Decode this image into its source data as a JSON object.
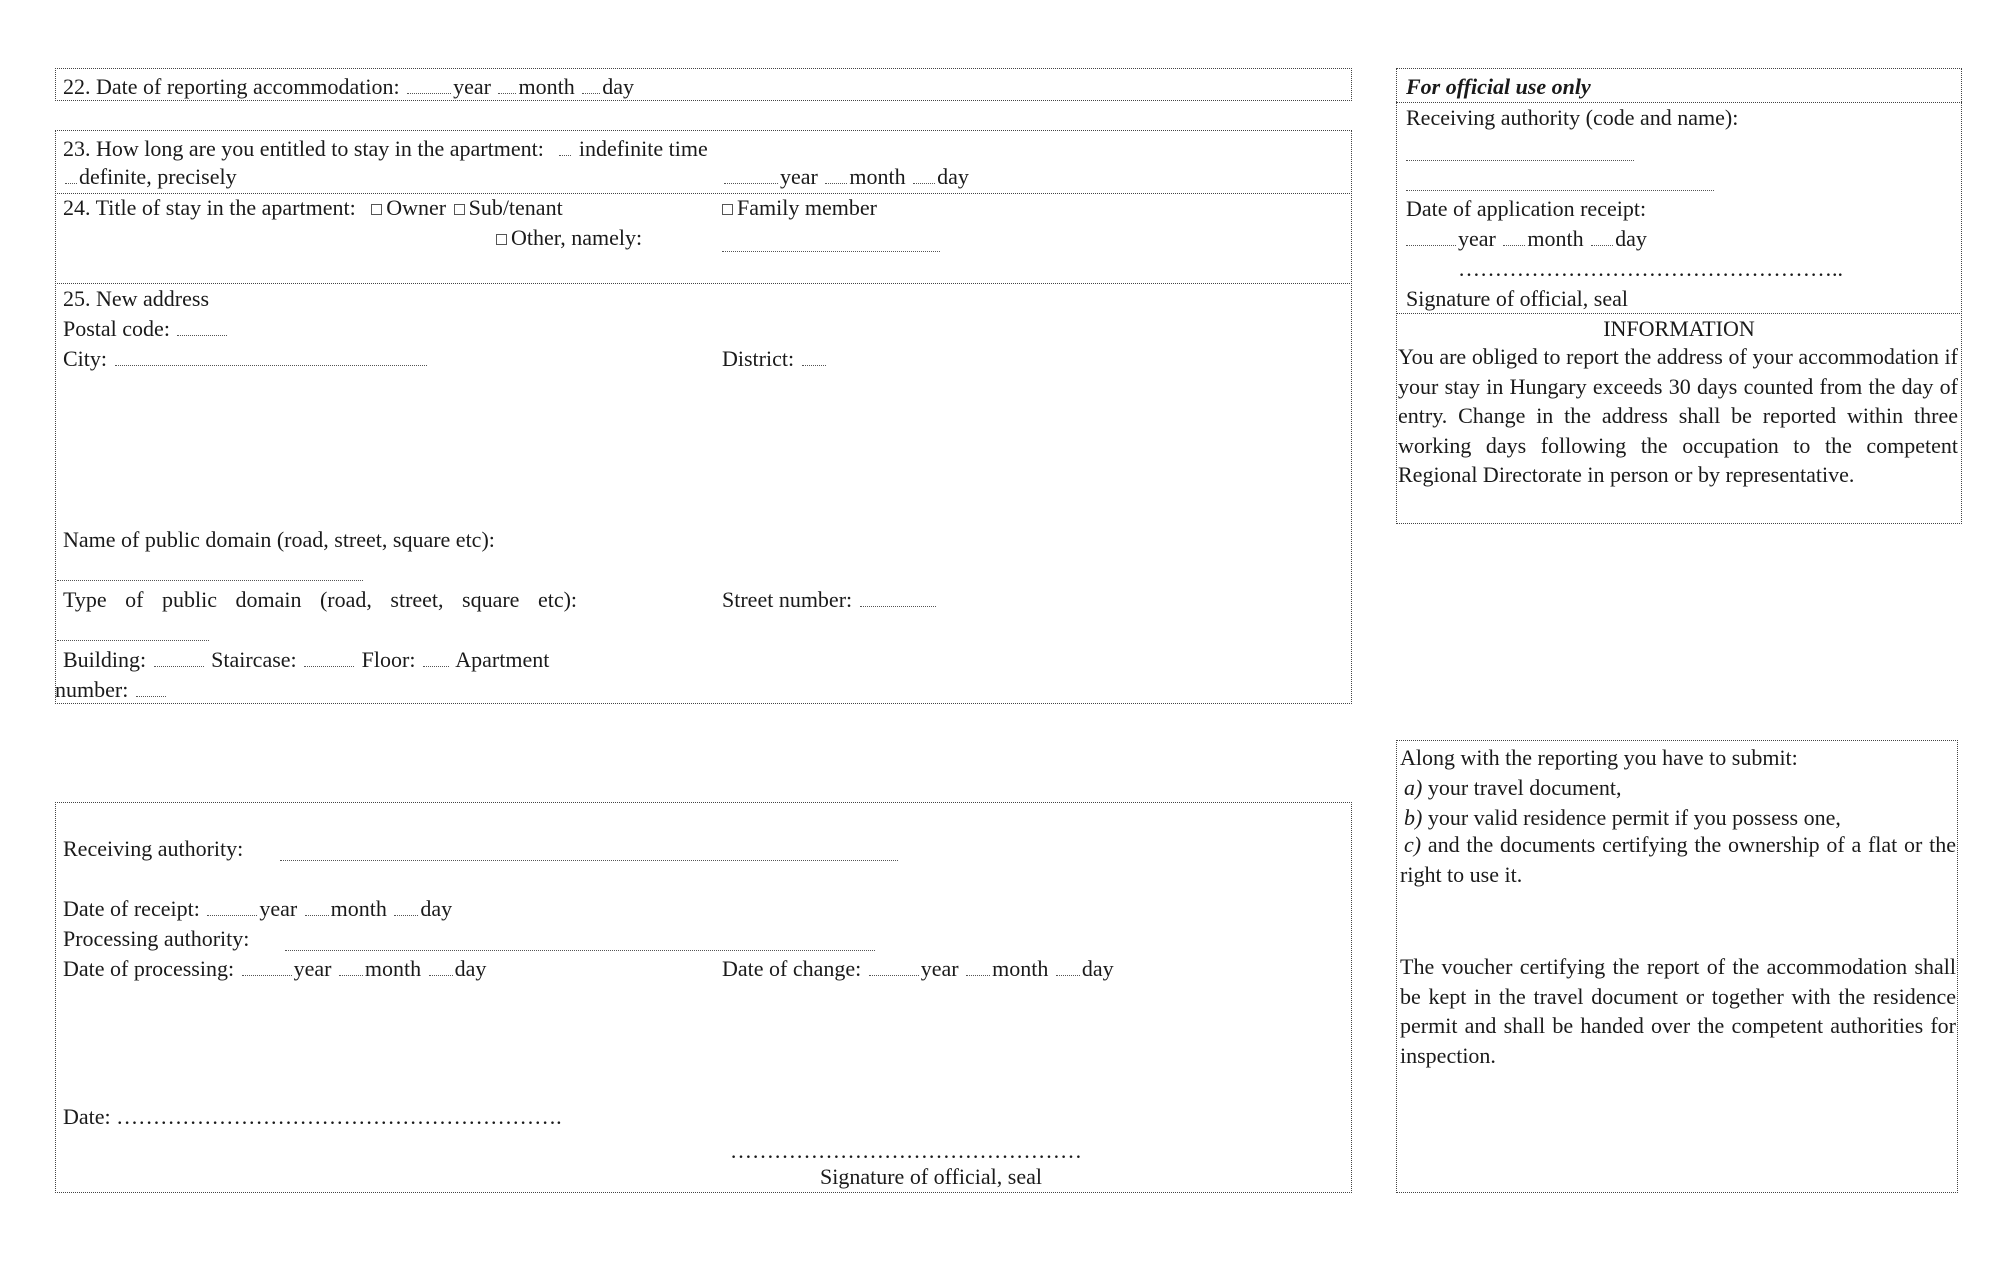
{
  "section22": {
    "label": "22. Date of reporting accommodation:",
    "year": "year",
    "month": "month",
    "day": "day"
  },
  "section23": {
    "label": "23. How long are you entitled to stay in the apartment:",
    "option_indefinite": "indefinite time",
    "option_definite": "definite, precisely",
    "year": "year",
    "month": "month",
    "day": "day"
  },
  "section24": {
    "label": "24. Title of stay in the apartment:",
    "options": [
      "Owner",
      "Sub/tenant",
      "Family member",
      "Other, namely:"
    ]
  },
  "section25": {
    "label": "25. New address",
    "postal_code": "Postal code:",
    "city": "City:",
    "district": "District:",
    "public_domain_name": "Name of public domain (road, street, square etc):",
    "public_domain_type": "Type of public domain (road, street, square etc):",
    "street_number": "Street number:",
    "building": "Building:",
    "staircase": "Staircase:",
    "floor": "Floor:",
    "apartment_number_1": "Apartment",
    "apartment_number_2": "number:"
  },
  "processing": {
    "receiving_authority": "Receiving authority:",
    "date_of_receipt": "Date of receipt:",
    "processing_authority": "Processing authority:",
    "date_of_processing": "Date of processing:",
    "date_of_change": "Date of change:",
    "year": "year",
    "month": "month",
    "day": "day",
    "date": "Date:",
    "date_dots": "…………………………………………………….",
    "signature_dots": "…………………………………………",
    "signature": "Signature of official, seal"
  },
  "official": {
    "header": "For official use only",
    "receiving_authority": "Receiving authority (code and name):",
    "date_of_application_receipt": "Date of application receipt:",
    "year": "year",
    "month": "month",
    "day": "day",
    "signature_dots": "……………………………………………..",
    "signature": "Signature of official, seal"
  },
  "information": {
    "title": "INFORMATION",
    "text": "You are obliged to report the address of your accommodation if your stay in Hungary exceeds 30 days counted from the day of entry. Change in the address shall be reported within three working days following the occupation to the competent Regional Directorate in person or by representative."
  },
  "submit": {
    "intro": "Along with the reporting you have to submit:",
    "items": [
      {
        "marker": "a)",
        "text": "your travel document,"
      },
      {
        "marker": "b)",
        "text": "your valid residence permit if you possess one,"
      },
      {
        "marker": "c)",
        "text": "and the documents certifying the ownership of a flat or the right to use it."
      }
    ],
    "voucher": "The voucher certifying the report of the accommodation shall be kept in the travel document or together with the residence permit and shall be handed over the competent authorities for inspection."
  }
}
